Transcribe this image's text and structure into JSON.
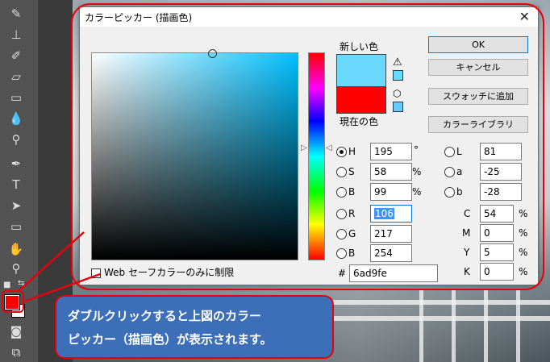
{
  "dialog": {
    "title": "カラーピッカー (描画色)",
    "close_glyph": "✕",
    "new_color_label": "新しい色",
    "current_color_label": "現在の色",
    "new_color": "#6ad9fe",
    "current_color": "#ff0000",
    "buttons": {
      "ok": "OK",
      "cancel": "キャンセル",
      "add_swatch": "スウォッチに追加",
      "color_library": "カラーライブラリ"
    },
    "hsb": [
      {
        "key": "H",
        "value": "195",
        "unit": "°",
        "selected": true
      },
      {
        "key": "S",
        "value": "58",
        "unit": "%",
        "selected": false
      },
      {
        "key": "B",
        "value": "99",
        "unit": "%",
        "selected": false
      }
    ],
    "rgb": [
      {
        "key": "R",
        "value": "106"
      },
      {
        "key": "G",
        "value": "217"
      },
      {
        "key": "B",
        "value": "254"
      }
    ],
    "lab": [
      {
        "key": "L",
        "value": "81"
      },
      {
        "key": "a",
        "value": "-25"
      },
      {
        "key": "b",
        "value": "-28"
      }
    ],
    "cmyk": [
      {
        "key": "C",
        "value": "54",
        "unit": "%"
      },
      {
        "key": "M",
        "value": "0",
        "unit": "%"
      },
      {
        "key": "Y",
        "value": "5",
        "unit": "%"
      },
      {
        "key": "K",
        "value": "0",
        "unit": "%"
      }
    ],
    "hex_prefix": "#",
    "hex_value": "6ad9fe",
    "web_safe_label": "Web セーフカラーのみに制限",
    "picker_hue_color": "#00bfff"
  },
  "annotation": {
    "callout_line1": "ダブルクリックすると上図のカラー",
    "callout_line2": "ピッカー（描画色）が表示されます。",
    "highlight_color": "#e8000a"
  }
}
